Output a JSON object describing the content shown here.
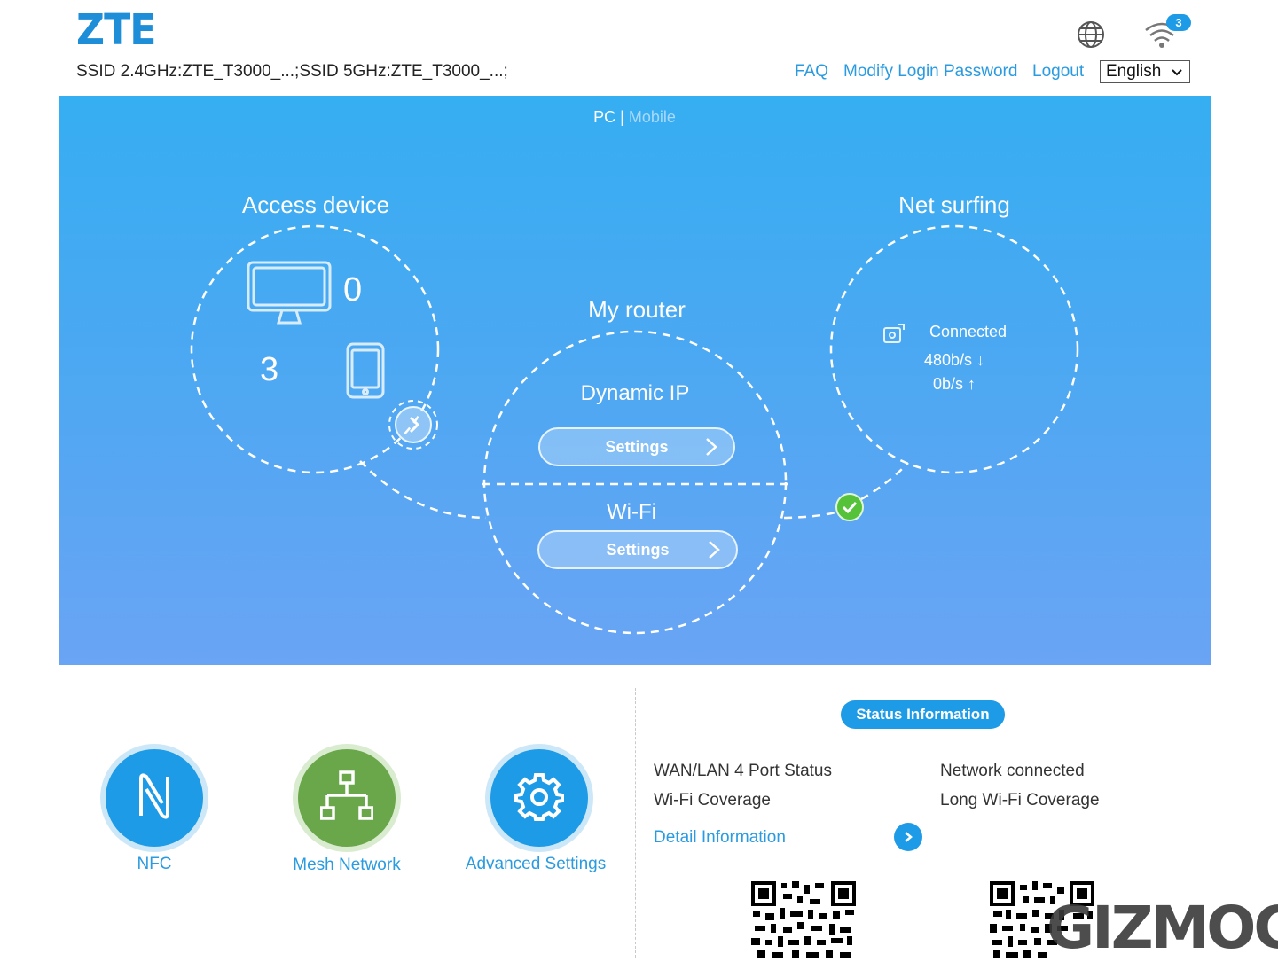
{
  "header": {
    "logo": "ZTE",
    "ssid_text": "SSID 2.4GHz:ZTE_T3000_...;SSID 5GHz:ZTE_T3000_...;",
    "links": {
      "faq": "FAQ",
      "modify_password": "Modify Login Password",
      "logout": "Logout"
    },
    "language": "English",
    "wifi_badge": "3",
    "icons": [
      "globe-icon",
      "wifi-icon"
    ]
  },
  "hero": {
    "mode_pc": "PC",
    "mode_sep": "|",
    "mode_mobile": "Mobile",
    "access_device": {
      "title": "Access device",
      "pc_count": "0",
      "mobile_count": "3"
    },
    "my_router": {
      "title": "My router",
      "wan_mode": "Dynamic IP",
      "settings_label": "Settings",
      "wifi_title": "Wi-Fi",
      "wifi_settings_label": "Settings"
    },
    "net_surfing": {
      "title": "Net surfing",
      "status": "Connected",
      "download": "480b/s ↓",
      "upload": "0b/s ↑"
    }
  },
  "tiles": [
    {
      "label": "NFC",
      "icon": "nfc-icon"
    },
    {
      "label": "Mesh Network",
      "icon": "mesh-network-icon"
    },
    {
      "label": "Advanced Settings",
      "icon": "gear-icon"
    }
  ],
  "status": {
    "title": "Status Information",
    "rows": [
      {
        "label": "WAN/LAN 4 Port Status",
        "value": "Network connected"
      },
      {
        "label": "Wi-Fi Coverage",
        "value": "Long Wi-Fi Coverage"
      }
    ],
    "detail_link": "Detail Information"
  },
  "watermark": "GIZMOCH",
  "colors": {
    "accent": "#2a9be0",
    "hero_top": "#36aef2",
    "hero_bottom": "#6aa4f4",
    "mesh_green": "#6aa64a",
    "check_green": "#55c23a"
  }
}
